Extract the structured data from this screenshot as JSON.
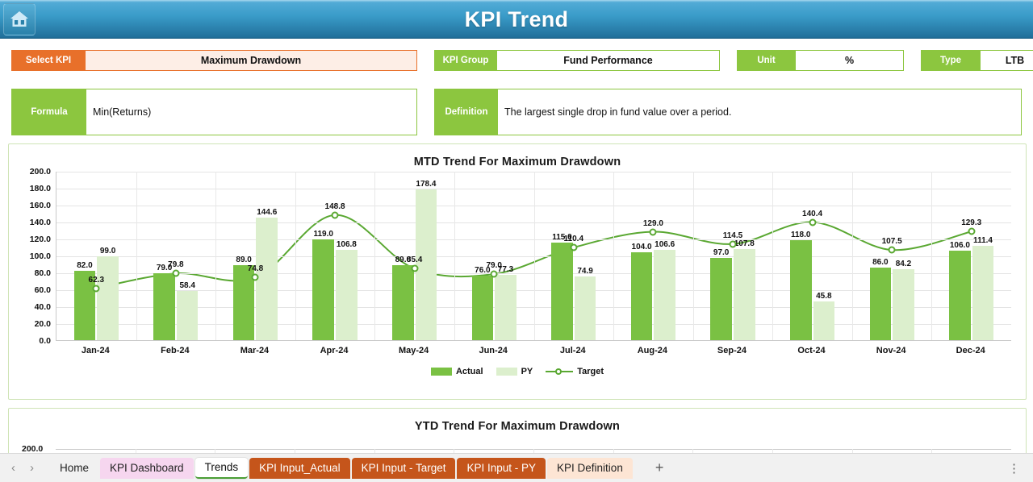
{
  "header": {
    "title": "KPI Trend",
    "home_icon": "home-icon"
  },
  "selectors": [
    {
      "key": "select_kpi",
      "label": "Select KPI",
      "value": "Maximum Drawdown"
    },
    {
      "key": "kpi_group",
      "label": "KPI Group",
      "value": "Fund Performance"
    },
    {
      "key": "unit",
      "label": "Unit",
      "value": "%"
    },
    {
      "key": "type",
      "label": "Type",
      "value": "LTB"
    }
  ],
  "meta": {
    "formula_label": "Formula",
    "formula_value": "Min(Returns)",
    "definition_label": "Definition",
    "definition_value": "The largest single drop in fund value over a period."
  },
  "charts": {
    "mtd_title": "MTD Trend For Maximum Drawdown",
    "ytd_title": "YTD Trend For Maximum Drawdown"
  },
  "legend": [
    {
      "name": "Actual",
      "type": "bar",
      "color": "#7ac143"
    },
    {
      "name": "PY",
      "type": "bar",
      "color": "#dcefcd"
    },
    {
      "name": "Target",
      "type": "line",
      "color": "#5aa832"
    }
  ],
  "chart_data": {
    "type": "bar",
    "title": "MTD Trend For Maximum Drawdown",
    "xlabel": "",
    "ylabel": "",
    "ylim": [
      0,
      200
    ],
    "ytick_step": 20,
    "ytick_labels": [
      "0.0",
      "20.0",
      "40.0",
      "60.0",
      "80.0",
      "100.0",
      "120.0",
      "140.0",
      "160.0",
      "180.0",
      "200.0"
    ],
    "grid": true,
    "legend_position": "bottom",
    "categories": [
      "Jan-24",
      "Feb-24",
      "Mar-24",
      "Apr-24",
      "May-24",
      "Jun-24",
      "Jul-24",
      "Aug-24",
      "Sep-24",
      "Oct-24",
      "Nov-24",
      "Dec-24"
    ],
    "series": [
      {
        "name": "Actual",
        "type": "bar",
        "color": "#7ac143",
        "values": [
          82.0,
          79.0,
          89.0,
          119.0,
          89.0,
          76.0,
          115.0,
          104.0,
          97.0,
          118.0,
          86.0,
          106.0
        ]
      },
      {
        "name": "PY",
        "type": "bar",
        "color": "#dcefcd",
        "values": [
          99.0,
          58.4,
          144.6,
          106.8,
          178.4,
          77.3,
          74.9,
          106.6,
          107.8,
          45.8,
          84.2,
          111.4
        ]
      },
      {
        "name": "Target",
        "type": "line",
        "color": "#5aa832",
        "values": [
          62.3,
          79.8,
          74.8,
          148.8,
          85.4,
          79.0,
          110.4,
          129.0,
          114.5,
          140.4,
          107.5,
          129.3
        ]
      }
    ]
  },
  "ytd_chart": {
    "ytick_labels": [
      "200.0"
    ]
  },
  "sheet_tabs": {
    "prev_icon": "chevron-left-icon",
    "next_icon": "chevron-right-icon",
    "add_label": "+",
    "menu_icon": "kebab-menu-icon",
    "items": [
      {
        "label": "Home",
        "style": "plain",
        "active": false
      },
      {
        "label": "KPI Dashboard",
        "style": "pink",
        "active": false
      },
      {
        "label": "Trends",
        "style": "active",
        "active": true
      },
      {
        "label": "KPI Input_Actual",
        "style": "orange",
        "active": false
      },
      {
        "label": "KPI Input - Target",
        "style": "orange",
        "active": false
      },
      {
        "label": "KPI Input - PY",
        "style": "orange",
        "active": false
      },
      {
        "label": "KPI Definition",
        "style": "peach",
        "active": false
      }
    ]
  }
}
